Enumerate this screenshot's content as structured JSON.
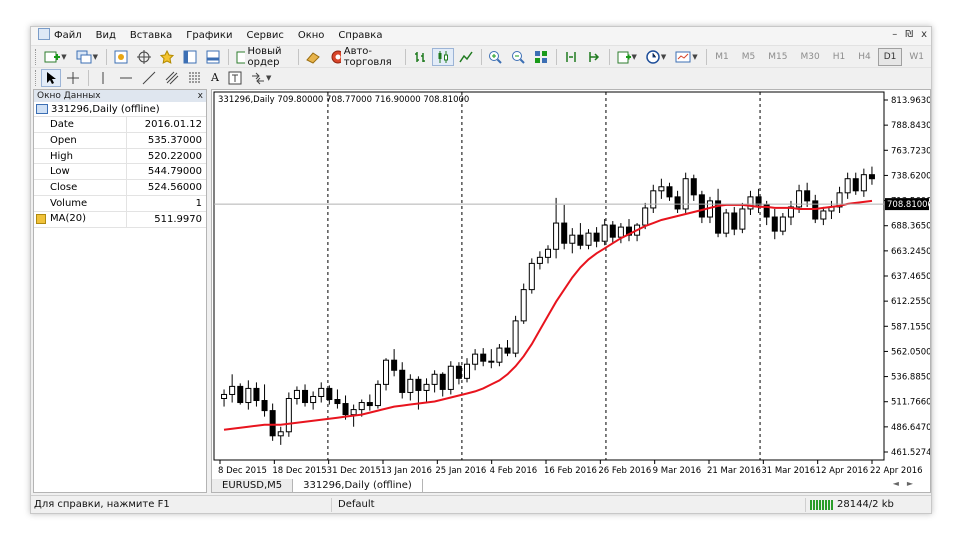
{
  "menu": [
    "Файл",
    "Вид",
    "Вставка",
    "Графики",
    "Сервис",
    "Окно",
    "Справка"
  ],
  "window_controls": [
    "–",
    "₪",
    "x"
  ],
  "toolbar": {
    "new_order": "Новый ордер",
    "auto_trading": "Авто-торговля",
    "timeframes": [
      "M1",
      "M5",
      "M15",
      "M30",
      "H1",
      "H4",
      "D1",
      "W1"
    ],
    "active_timeframe": "D1",
    "text_tool": "A"
  },
  "data_window": {
    "title": "Окно Данных",
    "close": "x",
    "symbol": "331296,Daily (offline)",
    "rows": [
      {
        "label": "Date",
        "value": "2016.01.12"
      },
      {
        "label": "Open",
        "value": "535.37000"
      },
      {
        "label": "High",
        "value": "520.22000"
      },
      {
        "label": "Low",
        "value": "544.79000"
      },
      {
        "label": "Close",
        "value": "524.56000"
      },
      {
        "label": "Volume",
        "value": "1"
      }
    ],
    "ma": {
      "label": "MA(20)",
      "value": "511.9970"
    }
  },
  "chart_data": {
    "type": "candlestick",
    "header": "331296,Daily  709.80000 708.77000 716.90000 708.81000",
    "current_price_label": "708.81000",
    "current_price": 708.81,
    "ylim": [
      455,
      820
    ],
    "y_ticks": [
      "813.96300",
      "788.84300",
      "763.72300",
      "738.62000",
      "713.56000",
      "688.36500",
      "663.24500",
      "637.46500",
      "612.25500",
      "587.15500",
      "562.05000",
      "536.88500",
      "511.76600",
      "486.64700",
      "461.52740"
    ],
    "x_ticks": [
      "8 Dec 2015",
      "18 Dec 2015",
      "31 Dec 2015",
      "13 Jan 2016",
      "25 Jan 2016",
      "4 Feb 2016",
      "16 Feb 2016",
      "26 Feb 2016",
      "9 Mar 2016",
      "21 Mar 2016",
      "31 Mar 2016",
      "12 Apr 2016",
      "22 Apr 2016"
    ],
    "period_separators": [
      "31 Dec 2015",
      "31 Jan 2016",
      "29 Feb 2016",
      "31 Mar 2016"
    ],
    "candles": [
      [
        516,
        525,
        508,
        520
      ],
      [
        520,
        540,
        512,
        528
      ],
      [
        528,
        531,
        510,
        512
      ],
      [
        512,
        534,
        505,
        526
      ],
      [
        526,
        532,
        508,
        514
      ],
      [
        514,
        530,
        498,
        504
      ],
      [
        504,
        511,
        474,
        479
      ],
      [
        479,
        488,
        470,
        483
      ],
      [
        483,
        522,
        478,
        516
      ],
      [
        516,
        528,
        510,
        524
      ],
      [
        524,
        530,
        508,
        512
      ],
      [
        512,
        523,
        505,
        518
      ],
      [
        518,
        532,
        512,
        526
      ],
      [
        526,
        529,
        510,
        515
      ],
      [
        515,
        525,
        506,
        511
      ],
      [
        511,
        519,
        495,
        500
      ],
      [
        500,
        510,
        488,
        505
      ],
      [
        505,
        515,
        498,
        512
      ],
      [
        512,
        520,
        504,
        509
      ],
      [
        509,
        534,
        506,
        530
      ],
      [
        530,
        556,
        524,
        554
      ],
      [
        554,
        565,
        538,
        544
      ],
      [
        544,
        552,
        516,
        522
      ],
      [
        522,
        540,
        514,
        535
      ],
      [
        535,
        538,
        505,
        524
      ],
      [
        524,
        536,
        512,
        530
      ],
      [
        530,
        544,
        522,
        540
      ],
      [
        540,
        542,
        518,
        525
      ],
      [
        525,
        553,
        520,
        548
      ],
      [
        548,
        552,
        530,
        536
      ],
      [
        536,
        556,
        532,
        550
      ],
      [
        550,
        565,
        544,
        560
      ],
      [
        560,
        566,
        548,
        553
      ],
      [
        553,
        565,
        546,
        552
      ],
      [
        552,
        570,
        548,
        566
      ],
      [
        566,
        574,
        558,
        561
      ],
      [
        561,
        598,
        557,
        593
      ],
      [
        593,
        630,
        590,
        624
      ],
      [
        624,
        655,
        620,
        650
      ],
      [
        650,
        662,
        644,
        656
      ],
      [
        656,
        668,
        650,
        664
      ],
      [
        664,
        715,
        655,
        690
      ],
      [
        690,
        708,
        664,
        670
      ],
      [
        670,
        685,
        660,
        678
      ],
      [
        678,
        690,
        664,
        668
      ],
      [
        668,
        684,
        664,
        680
      ],
      [
        680,
        686,
        666,
        672
      ],
      [
        672,
        694,
        668,
        688
      ],
      [
        688,
        692,
        670,
        676
      ],
      [
        676,
        690,
        670,
        686
      ],
      [
        686,
        694,
        672,
        678
      ],
      [
        678,
        690,
        672,
        688
      ],
      [
        688,
        710,
        684,
        705
      ],
      [
        705,
        728,
        700,
        722
      ],
      [
        722,
        734,
        714,
        726
      ],
      [
        726,
        730,
        712,
        716
      ],
      [
        716,
        722,
        700,
        704
      ],
      [
        704,
        740,
        700,
        734
      ],
      [
        734,
        738,
        712,
        718
      ],
      [
        718,
        722,
        690,
        696
      ],
      [
        696,
        716,
        690,
        712
      ],
      [
        712,
        724,
        676,
        680
      ],
      [
        680,
        704,
        676,
        700
      ],
      [
        700,
        706,
        678,
        684
      ],
      [
        684,
        710,
        680,
        704
      ],
      [
        704,
        722,
        698,
        716
      ],
      [
        716,
        724,
        700,
        708
      ],
      [
        708,
        712,
        688,
        696
      ],
      [
        696,
        704,
        674,
        682
      ],
      [
        682,
        700,
        678,
        696
      ],
      [
        696,
        712,
        688,
        706
      ],
      [
        706,
        728,
        700,
        722
      ],
      [
        722,
        730,
        706,
        712
      ],
      [
        712,
        718,
        690,
        694
      ],
      [
        694,
        706,
        688,
        702
      ],
      [
        702,
        712,
        694,
        706
      ],
      [
        706,
        726,
        700,
        720
      ],
      [
        720,
        740,
        714,
        734
      ],
      [
        734,
        740,
        718,
        722
      ],
      [
        722,
        744,
        716,
        738
      ],
      [
        738,
        746,
        728,
        734
      ]
    ],
    "ma20": [
      485,
      486,
      487,
      488,
      489,
      490,
      490,
      490,
      491,
      492,
      493,
      494,
      495,
      496,
      497,
      498,
      499,
      500,
      502,
      504,
      506,
      508,
      509,
      510,
      511,
      512,
      513,
      515,
      517,
      519,
      521,
      523,
      526,
      530,
      534,
      540,
      548,
      558,
      570,
      584,
      598,
      612,
      624,
      636,
      646,
      654,
      660,
      665,
      670,
      675,
      679,
      683,
      687,
      690,
      693,
      695,
      697,
      699,
      701,
      703,
      705,
      707,
      708,
      708,
      708,
      707,
      706,
      706,
      705,
      705,
      705,
      704,
      704,
      704,
      705,
      706,
      707,
      709,
      710,
      711,
      712
    ]
  },
  "tabs": [
    "EURUSD,M5",
    "331296,Daily (offline)"
  ],
  "active_tab": "331296,Daily (offline)",
  "status": {
    "help": "Для справки, нажмите F1",
    "profile": "Default",
    "traffic": "28144/2 kb"
  },
  "colors": {
    "ma_line": "#e8141e",
    "bull_fill": "#ffffff",
    "bear_fill": "#000000",
    "price_label_bg": "#000000"
  }
}
